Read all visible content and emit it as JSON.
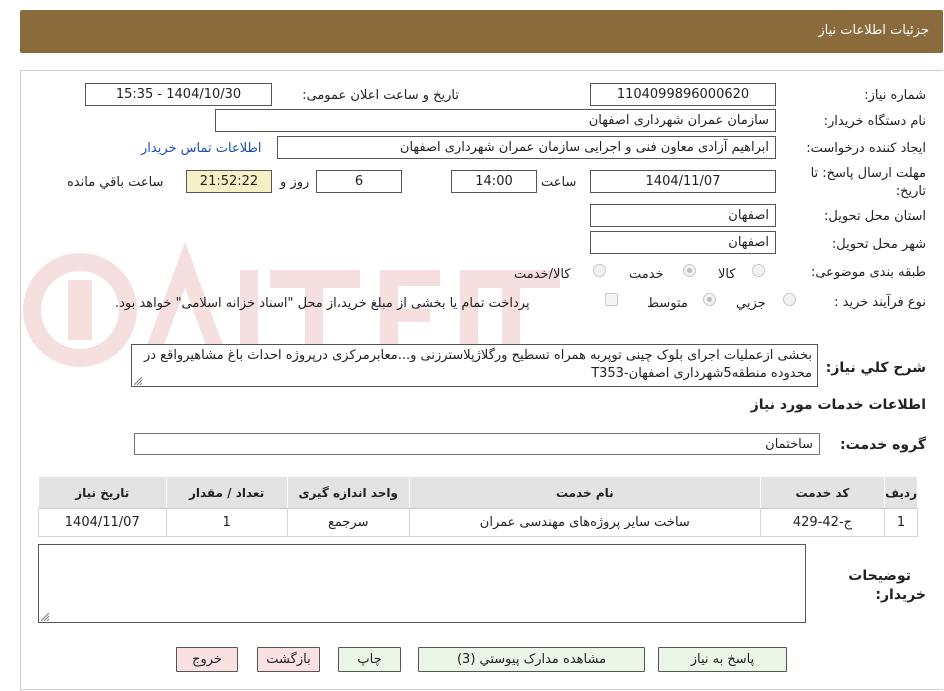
{
  "header": {
    "title": "جزئیات اطلاعات نیاز"
  },
  "form": {
    "need_number_label": "شماره نیاز:",
    "need_number": "1104099896000620",
    "announce_label": "تاریخ و ساعت اعلان عمومی:",
    "announce_value": "1404/10/30 - 15:35",
    "buyer_org_label": "نام دستگاه خریدار:",
    "buyer_org": "سازمان عمران شهرداری اصفهان",
    "requester_label": "ایجاد کننده درخواست:",
    "requester": "ابراهیم آزادی معاون فنی و اجرایی سازمان عمران شهرداری اصفهان",
    "contact_link": "اطلاعات تماس خریدار",
    "deadline_label_1": "مهلت ارسال پاسخ: تا",
    "deadline_label_2": "تاریخ:",
    "deadline_date": "1404/11/07",
    "time_label": "ساعت",
    "deadline_time": "14:00",
    "days": "6",
    "days_label": "روز و",
    "remaining_time": "21:52:22",
    "remaining_label": "ساعت باقي مانده",
    "province_label": "استان محل تحویل:",
    "province": "اصفهان",
    "city_label": "شهر محل تحویل:",
    "city": "اصفهان",
    "category_label": "طبقه بندی موضوعی:",
    "category_options": [
      "کالا",
      "خدمت",
      "کالا/خدمت"
    ],
    "purchase_type_label": "نوع فرآیند خرید :",
    "purchase_options": [
      "جزیي",
      "متوسط"
    ],
    "payment_note": "پرداخت تمام یا بخشی از مبلغ خرید،از محل \"اسناد خزانه اسلامی\" خواهد بود.",
    "description_label": "شرح کلي نیاز:",
    "description": "بخشی ازعملیات اجرای بلوک چینی توپربه همراه تسطیح ورگلاژپلاسترزنی و...معابرمرکزی درپروژه احداث باغ مشاهیرواقع در محدوده منطقه5شهرداری اصفهان-T353"
  },
  "services": {
    "section_title": "اطلاعات خدمات مورد نیاز",
    "group_label": "گروه خدمت:",
    "group_value": "ساختمان",
    "columns": [
      "ردیف",
      "کد خدمت",
      "نام خدمت",
      "واحد اندازه گیری",
      "تعداد / مقدار",
      "تاریخ نیاز"
    ],
    "rows": [
      [
        "1",
        "ج-42-429",
        "ساخت سایر پروژه‌های مهندسی عمران",
        "سرجمع",
        "1",
        "1404/11/07"
      ]
    ]
  },
  "buyer_notes": {
    "label_1": "توضیحات",
    "label_2": "خریدار:"
  },
  "buttons": {
    "reply": "پاسخ به نیاز",
    "attachments": "مشاهده مدارک پیوستي (3)",
    "print": "چاپ",
    "back": "بازگشت",
    "exit": "خروج"
  },
  "colors": {
    "header": "#8b6a3c",
    "link": "#1a4fb5",
    "green_button": "#e9f6e6",
    "pink_button": "#fae1e1",
    "remaining_bg": "#f5f0c6"
  }
}
